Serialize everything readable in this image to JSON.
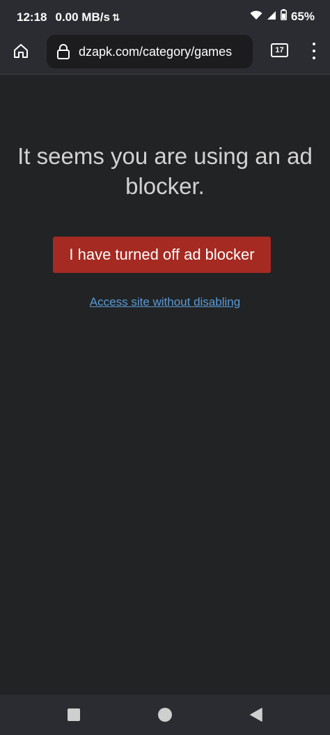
{
  "status_bar": {
    "time": "12:18",
    "speed": "0.00 MB/s",
    "battery_percent": "65%",
    "icons": [
      "data-arrows-icon",
      "wifi-icon",
      "signal-icon",
      "battery-icon"
    ]
  },
  "browser": {
    "url": "dzapk.com/category/games",
    "tab_count": "17",
    "icons": [
      "home-icon",
      "lock-icon",
      "tabs-icon",
      "more-menu-icon"
    ]
  },
  "page": {
    "heading": "It seems you are using an ad blocker.",
    "primary_button": "I have turned off ad blocker",
    "secondary_link": "Access site without disabling"
  },
  "nav_bar": {
    "icons": [
      "recents-square-icon",
      "home-circle-icon",
      "back-triangle-icon"
    ]
  },
  "colors": {
    "background": "#222325",
    "chrome": "#2b2c31",
    "button_red": "#a52a22",
    "link_blue": "#5a9bd6",
    "heading_text": "#d2d2d2"
  }
}
